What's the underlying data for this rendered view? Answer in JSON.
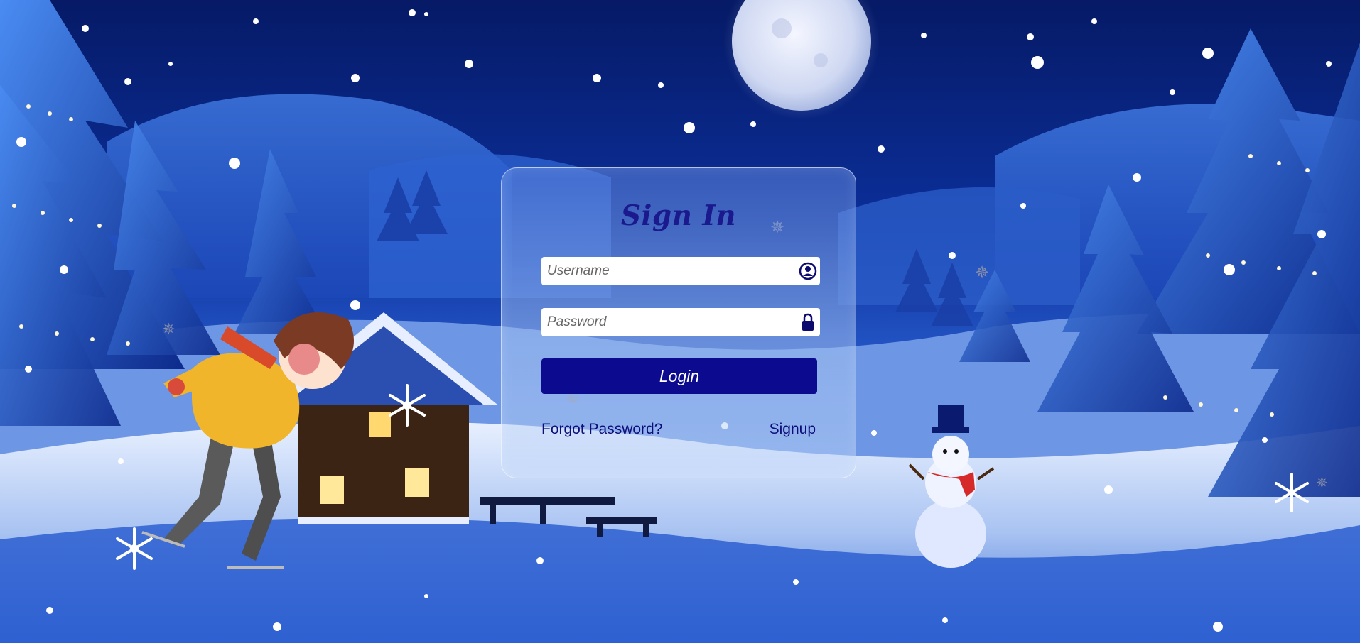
{
  "login_card": {
    "title": "Sign In",
    "username": {
      "placeholder": "Username",
      "value": "",
      "icon": "user-circle-icon"
    },
    "password": {
      "placeholder": "Password",
      "value": "",
      "icon": "lock-icon"
    },
    "login_button_label": "Login",
    "forgot_password_label": "Forgot Password?",
    "signup_label": "Signup"
  },
  "colors": {
    "title": "#1a1a8e",
    "button": "#0c0a8e",
    "link": "#0d0d7a",
    "background": "#0a2a8a"
  },
  "decorations": [
    "winter-night-scene",
    "moon",
    "snow-covered-pine-trees",
    "cabin",
    "snowman",
    "ice-skater-girl",
    "snowflakes"
  ]
}
